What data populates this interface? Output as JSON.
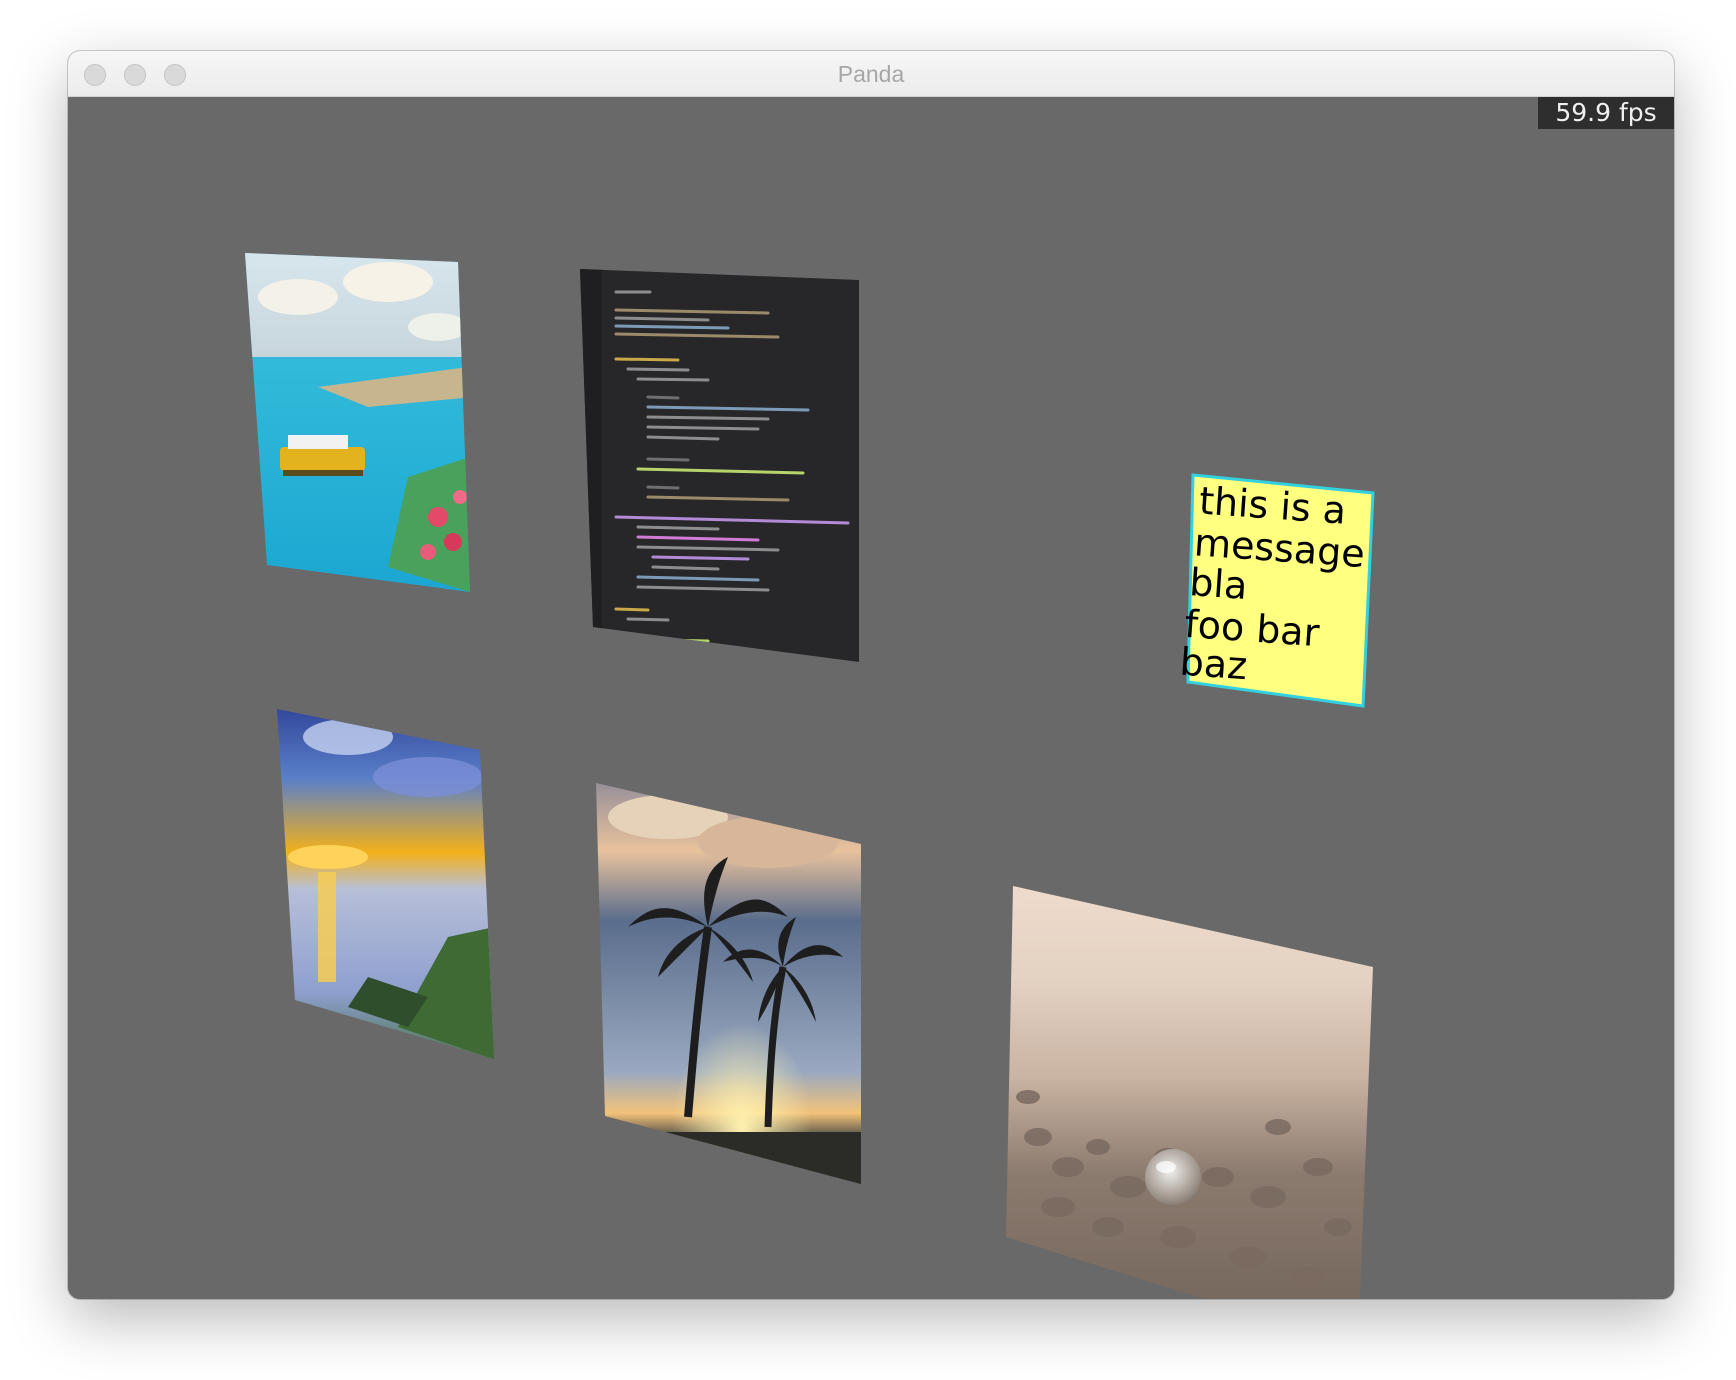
{
  "window": {
    "title": "Panda"
  },
  "overlay": {
    "fps_text": "59.9 fps"
  },
  "scene": {
    "background_color": "#696969",
    "note": {
      "lines": [
        "this is a",
        "message",
        "bla",
        "foo bar",
        "baz"
      ],
      "background_color": "#ffff80",
      "border_color": "#33d1e0"
    },
    "cards": [
      {
        "name": "card-harbor-photo",
        "subject": "coastal harbor with yellow ferry"
      },
      {
        "name": "card-code-screenshot",
        "subject": "dark code editor screenshot"
      },
      {
        "name": "card-sunset-photo",
        "subject": "sunset over bay"
      },
      {
        "name": "card-palm-trees-photo",
        "subject": "palm trees at sunset"
      },
      {
        "name": "card-pebbles-photo",
        "subject": "glass ball on pebble beach"
      }
    ]
  }
}
